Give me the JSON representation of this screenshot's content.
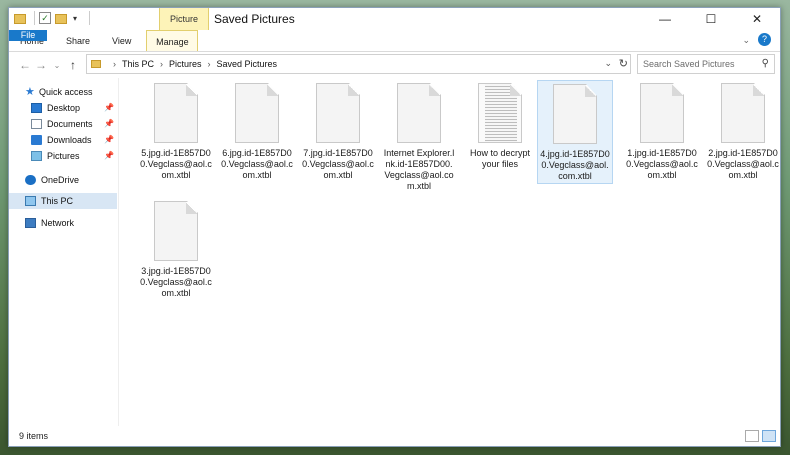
{
  "window": {
    "contextual_tab": "Picture Tools",
    "title": "Saved Pictures",
    "minimize_icon": "minimize-icon",
    "maximize_icon": "maximize-icon",
    "close_icon": "close-icon"
  },
  "ribbon": {
    "tabs": [
      "File",
      "Home",
      "Share",
      "View",
      "Manage"
    ]
  },
  "address": {
    "breadcrumb": [
      "This PC",
      "Pictures",
      "Saved Pictures"
    ],
    "search_placeholder": "Search Saved Pictures"
  },
  "sidebar": {
    "items": [
      {
        "label": "Quick access",
        "icon": "star-icon"
      },
      {
        "label": "Desktop",
        "icon": "desktop-icon",
        "pinned": true
      },
      {
        "label": "Documents",
        "icon": "documents-icon",
        "pinned": true
      },
      {
        "label": "Downloads",
        "icon": "downloads-icon",
        "pinned": true
      },
      {
        "label": "Pictures",
        "icon": "pictures-icon",
        "pinned": true
      },
      {
        "label": "OneDrive",
        "icon": "onedrive-icon"
      },
      {
        "label": "This PC",
        "icon": "this-pc-icon",
        "selected": true
      },
      {
        "label": "Network",
        "icon": "network-icon"
      }
    ]
  },
  "files": [
    {
      "name": "5.jpg.id-1E857D00.Vegclass@aol.com.xtbl"
    },
    {
      "name": "6.jpg.id-1E857D00.Vegclass@aol.com.xtbl"
    },
    {
      "name": "7.jpg.id-1E857D00.Vegclass@aol.com.xtbl"
    },
    {
      "name": "Internet Explorer.lnk.id-1E857D00.Vegclass@aol.com.xtbl"
    },
    {
      "name": "How to decrypt your files"
    },
    {
      "name": "4.jpg.id-1E857D00.Vegclass@aol.com.xtbl",
      "selected": true
    },
    {
      "name": "1.jpg.id-1E857D00.Vegclass@aol.com.xtbl"
    },
    {
      "name": "2.jpg.id-1E857D00.Vegclass@aol.com.xtbl"
    },
    {
      "name": "3.jpg.id-1E857D00.Vegclass@aol.com.xtbl"
    }
  ],
  "status": {
    "count": "9 items"
  }
}
